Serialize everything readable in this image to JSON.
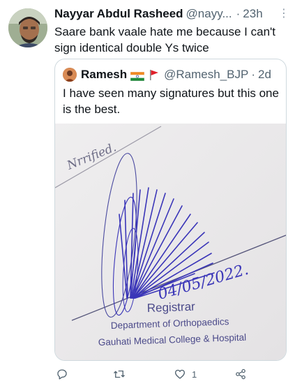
{
  "tweet": {
    "author_name": "Nayyar Abdul Rasheed",
    "author_handle": "@nayy...",
    "dot": "·",
    "time": "23h",
    "more": "⋮",
    "text": "Saare bank vaale hate me because I can't sign identical double Ys twice"
  },
  "quoted": {
    "author_name": "Ramesh",
    "author_handle": "@Ramesh_BJP",
    "dot": "·",
    "time": "2d",
    "text": "I have seen many signatures but this one is the best.",
    "photo_text": {
      "note": "Nrrified.",
      "date": "04/05/2022.",
      "stamp_title": "Registrar",
      "stamp_line1": "Department of Orthopaedics",
      "stamp_line2": "Gauhati Medical College & Hospital"
    }
  },
  "actions": {
    "reply_icon": "reply-icon",
    "retweet_icon": "retweet-icon",
    "like_icon": "heart-icon",
    "like_count": "1",
    "share_icon": "share-icon"
  },
  "colors": {
    "secondary_text": "#536471",
    "border": "#cfd9de",
    "ink": "#3a35b8"
  }
}
